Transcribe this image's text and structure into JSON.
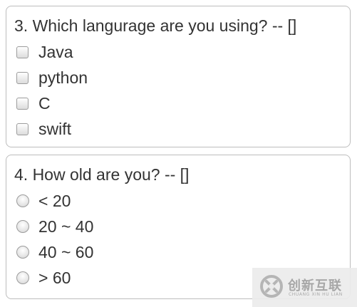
{
  "questions": [
    {
      "text": "3. Which langurage are you using? -- []",
      "type": "checkbox",
      "options": [
        "Java",
        "python",
        "C",
        "swift"
      ]
    },
    {
      "text": "4. How old are you? -- []",
      "type": "radio",
      "options": [
        "< 20",
        "20 ~ 40",
        "40 ~ 60",
        "> 60"
      ]
    }
  ],
  "watermark": {
    "icon": "brand-logo-icon",
    "name": "创新互联",
    "subtitle": "CHUANG XIN HU LIAN"
  },
  "colors": {
    "text": "#333333",
    "card_border": "#bdbdbd",
    "control_border": "#9c9c9c",
    "watermark": "#a7a7a7"
  }
}
